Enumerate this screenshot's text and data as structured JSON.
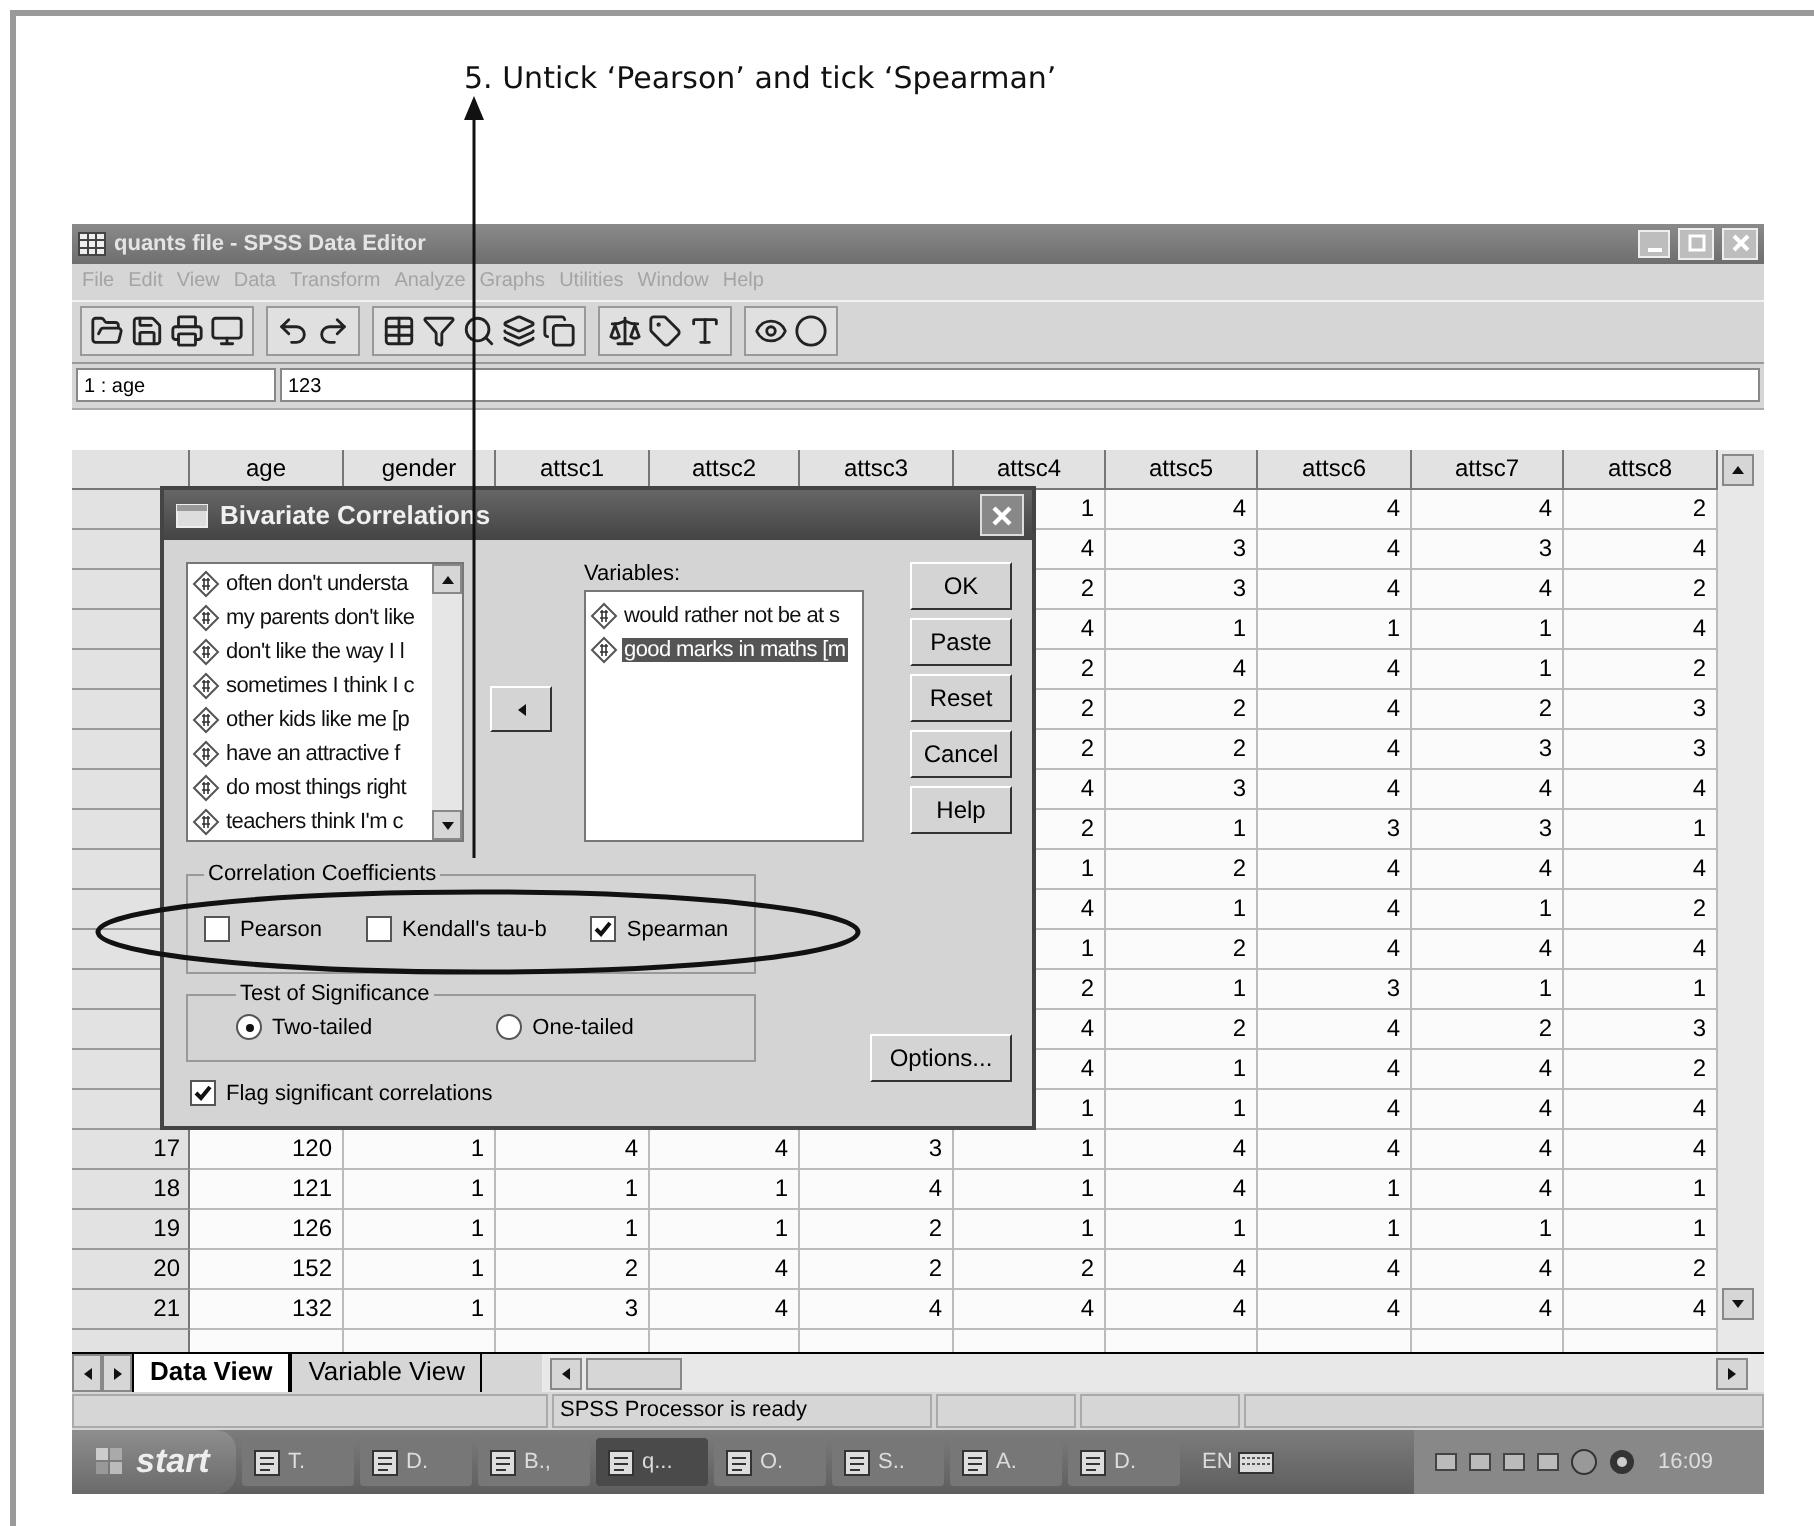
{
  "caption": "5. Untick ‘Pearson’ and tick ‘Spearman’",
  "window": {
    "title": "quants file - SPSS Data Editor"
  },
  "menu": [
    "File",
    "Edit",
    "View",
    "Data",
    "Transform",
    "Analyze",
    "Graphs",
    "Utilities",
    "Window",
    "Help"
  ],
  "cell_reference": {
    "cell": "1 : age",
    "value": "123"
  },
  "table": {
    "columns": [
      "age",
      "gender",
      "attsc1",
      "attsc2",
      "attsc3",
      "attsc4",
      "attsc5",
      "attsc6",
      "attsc7",
      "attsc8"
    ],
    "rows": [
      {
        "cells": [
          "1",
          "4",
          "4",
          "4",
          "2"
        ]
      },
      {
        "cells": [
          "4",
          "3",
          "4",
          "3",
          "4"
        ]
      },
      {
        "cells": [
          "2",
          "3",
          "4",
          "4",
          "2"
        ]
      },
      {
        "cells": [
          "4",
          "1",
          "1",
          "1",
          "4"
        ]
      },
      {
        "cells": [
          "2",
          "4",
          "4",
          "1",
          "2"
        ]
      },
      {
        "cells": [
          "2",
          "2",
          "4",
          "2",
          "3"
        ]
      },
      {
        "cells": [
          "2",
          "2",
          "4",
          "3",
          "3"
        ]
      },
      {
        "cells": [
          "4",
          "3",
          "4",
          "4",
          "4"
        ]
      },
      {
        "cells": [
          "2",
          "1",
          "3",
          "3",
          "1"
        ]
      },
      {
        "cells": [
          "1",
          "2",
          "4",
          "4",
          "4"
        ]
      },
      {
        "cells": [
          "4",
          "1",
          "4",
          "1",
          "2"
        ]
      },
      {
        "cells": [
          "1",
          "2",
          "4",
          "4",
          "4"
        ]
      },
      {
        "cells": [
          "2",
          "1",
          "3",
          "1",
          "1"
        ]
      },
      {
        "cells": [
          "4",
          "2",
          "4",
          "2",
          "3"
        ]
      },
      {
        "cells": [
          "4",
          "1",
          "4",
          "4",
          "2"
        ]
      },
      {
        "cells": [
          "1",
          "1",
          "4",
          "4",
          "4"
        ]
      },
      {
        "number": "17",
        "cells": [
          "120",
          "1",
          "4",
          "4",
          "3",
          "1",
          "4",
          "4",
          "4",
          "4"
        ]
      },
      {
        "number": "18",
        "cells": [
          "121",
          "1",
          "1",
          "1",
          "4",
          "1",
          "4",
          "1",
          "4",
          "1"
        ]
      },
      {
        "number": "19",
        "cells": [
          "126",
          "1",
          "1",
          "1",
          "2",
          "1",
          "1",
          "1",
          "1",
          "1"
        ]
      },
      {
        "number": "20",
        "cells": [
          "152",
          "1",
          "2",
          "4",
          "2",
          "2",
          "4",
          "4",
          "4",
          "2"
        ]
      },
      {
        "number": "21",
        "cells": [
          "132",
          "1",
          "3",
          "4",
          "4",
          "4",
          "4",
          "4",
          "4",
          "4"
        ]
      }
    ]
  },
  "dialog": {
    "title": "Bivariate Correlations",
    "source_list": [
      "often don't understa",
      "my parents don't like",
      "don't like the way I l",
      "sometimes I think I c",
      "other kids like me [p",
      "have an attractive f",
      "do most things right",
      "teachers think I'm c"
    ],
    "variables_label": "Variables:",
    "variables": [
      {
        "label": "would rather not be at s",
        "selected": false
      },
      {
        "label": "good marks in maths [m",
        "selected": true
      }
    ],
    "buttons": [
      "OK",
      "Paste",
      "Reset",
      "Cancel",
      "Help"
    ],
    "options_button": "Options...",
    "coefficients": {
      "title": "Correlation Coefficients",
      "options": [
        {
          "label": "Pearson",
          "checked": false
        },
        {
          "label": "Kendall's tau-b",
          "checked": false
        },
        {
          "label": "Spearman",
          "checked": true
        }
      ]
    },
    "significance": {
      "title": "Test of Significance",
      "options": [
        {
          "label": "Two-tailed",
          "selected": true
        },
        {
          "label": "One-tailed",
          "selected": false
        }
      ]
    },
    "flag": {
      "label": "Flag significant correlations",
      "checked": true
    }
  },
  "tabs": [
    {
      "label": "Data View",
      "selected": true
    },
    {
      "label": "Variable View",
      "selected": false
    }
  ],
  "status_bar": "SPSS Processor  is ready",
  "taskbar": {
    "start": "start",
    "items": [
      {
        "label": "T.",
        "selected": false
      },
      {
        "label": "D.",
        "selected": false
      },
      {
        "label": "B.,",
        "selected": false
      },
      {
        "label": "q...",
        "selected": true
      },
      {
        "label": "O.",
        "selected": false
      },
      {
        "label": "S..",
        "selected": false
      },
      {
        "label": "A.",
        "selected": false
      },
      {
        "label": "D.",
        "selected": false
      }
    ],
    "language": "EN",
    "clock": "16:09"
  }
}
